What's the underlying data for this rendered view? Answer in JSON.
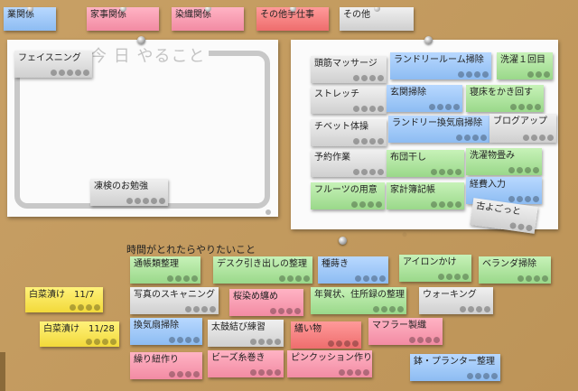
{
  "headings": {
    "today": "今 日 やること",
    "spare_time": "時間がとれたらやりたいこと"
  },
  "top_notes": [
    {
      "label": "業関係",
      "color": "blue"
    },
    {
      "label": "家事関係",
      "color": "pink"
    },
    {
      "label": "染織関係",
      "color": "pink"
    },
    {
      "label": "その他手仕事",
      "color": "red"
    },
    {
      "label": "その他",
      "color": "gray"
    }
  ],
  "today_notes": [
    {
      "label": "フェイスニング",
      "color": "gray"
    },
    {
      "label": "凍検のお勉強",
      "color": "gray"
    }
  ],
  "task_notes": [
    {
      "label": "頭筋マッサージ",
      "color": "gray"
    },
    {
      "label": "ランドリールーム掃除",
      "color": "blue"
    },
    {
      "label": "洗濯１回目",
      "color": "green"
    },
    {
      "label": "ストレッチ",
      "color": "gray"
    },
    {
      "label": "玄関掃除",
      "color": "blue"
    },
    {
      "label": "寝床をかき回す",
      "color": "green"
    },
    {
      "label": "チベット体操",
      "color": "gray"
    },
    {
      "label": "ランドリー換気扇掃除",
      "color": "blue"
    },
    {
      "label": "ブログアップ",
      "color": "gray"
    },
    {
      "label": "予約作業",
      "color": "gray"
    },
    {
      "label": "布団干し",
      "color": "green"
    },
    {
      "label": "洗濯物畳み",
      "color": "green"
    },
    {
      "label": "フルーツの用意",
      "color": "green"
    },
    {
      "label": "家計簿記帳",
      "color": "green"
    },
    {
      "label": "経費入力",
      "color": "blue"
    },
    {
      "label": "古よごっと",
      "color": "gray"
    }
  ],
  "spare_notes": [
    {
      "label": "通帳類整理",
      "color": "green"
    },
    {
      "label": "デスク引き出しの整理",
      "color": "green"
    },
    {
      "label": "種蒔き",
      "color": "blue"
    },
    {
      "label": "アイロンかけ",
      "color": "green"
    },
    {
      "label": "ベランダ掃除",
      "color": "green"
    },
    {
      "label": "写真のスキャニング",
      "color": "gray"
    },
    {
      "label": "桜染め纏め",
      "color": "pink"
    },
    {
      "label": "年賀状、住所録の整理",
      "color": "green"
    },
    {
      "label": "ウォーキング",
      "color": "gray"
    },
    {
      "label": "換気扇掃除",
      "color": "blue"
    },
    {
      "label": "太鼓結び練習",
      "color": "gray"
    },
    {
      "label": "繕い物",
      "color": "red"
    },
    {
      "label": "マフラー製織",
      "color": "pink"
    },
    {
      "label": "繰り紐作り",
      "color": "pink"
    },
    {
      "label": "ビーズ糸巻き",
      "color": "pink"
    },
    {
      "label": "ピンクッション作り",
      "color": "pink"
    },
    {
      "label": "鉢・プランター整理",
      "color": "blue"
    }
  ],
  "side_notes": [
    {
      "label": "白菜漬け　11/7",
      "color": "yellow"
    },
    {
      "label": "白菜漬け　11/28",
      "color": "yellow"
    }
  ]
}
